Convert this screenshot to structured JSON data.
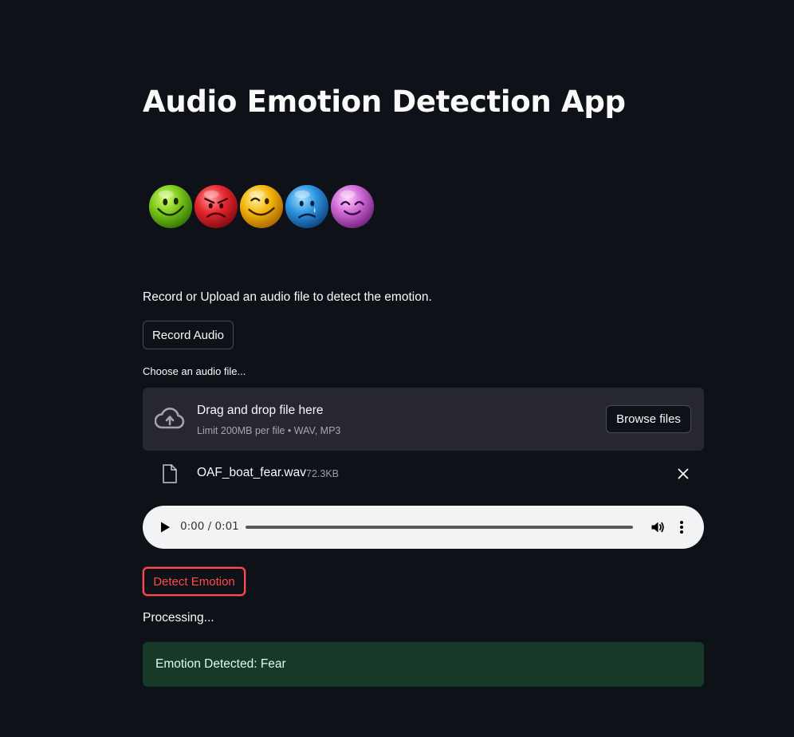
{
  "app": {
    "title": "Audio Emotion Detection App"
  },
  "emojis": [
    {
      "name": "happy-green",
      "color": "#7cc91b"
    },
    {
      "name": "angry-red",
      "color": "#e8262e"
    },
    {
      "name": "smirk-yellow",
      "color": "#f5b70a"
    },
    {
      "name": "sad-blue",
      "color": "#2e95e0"
    },
    {
      "name": "content-pink",
      "color": "#cf6ad6"
    }
  ],
  "instructions": "Record or Upload an audio file to detect the emotion.",
  "record_button_label": "Record Audio",
  "uploader": {
    "label": "Choose an audio file...",
    "dropzone_title": "Drag and drop file here",
    "limit_text": "Limit 200MB per file • WAV, MP3",
    "browse_label": "Browse files",
    "icon": "cloud-upload-icon"
  },
  "uploaded_file": {
    "name": "OAF_boat_fear.wav",
    "size": "72.3KB",
    "icon": "file-icon"
  },
  "audio_player": {
    "time": "0:00 / 0:01",
    "progress": 0
  },
  "detect_button_label": "Detect Emotion",
  "processing_text": "Processing...",
  "result": {
    "text": "Emotion Detected: Fear"
  },
  "colors": {
    "background": "#0e1117",
    "primary": "#ff4b4b",
    "dropzone": "#262730",
    "success_bg": "#173928",
    "success_text": "#dffde9",
    "audio_player_bg": "#f1f3f4"
  }
}
